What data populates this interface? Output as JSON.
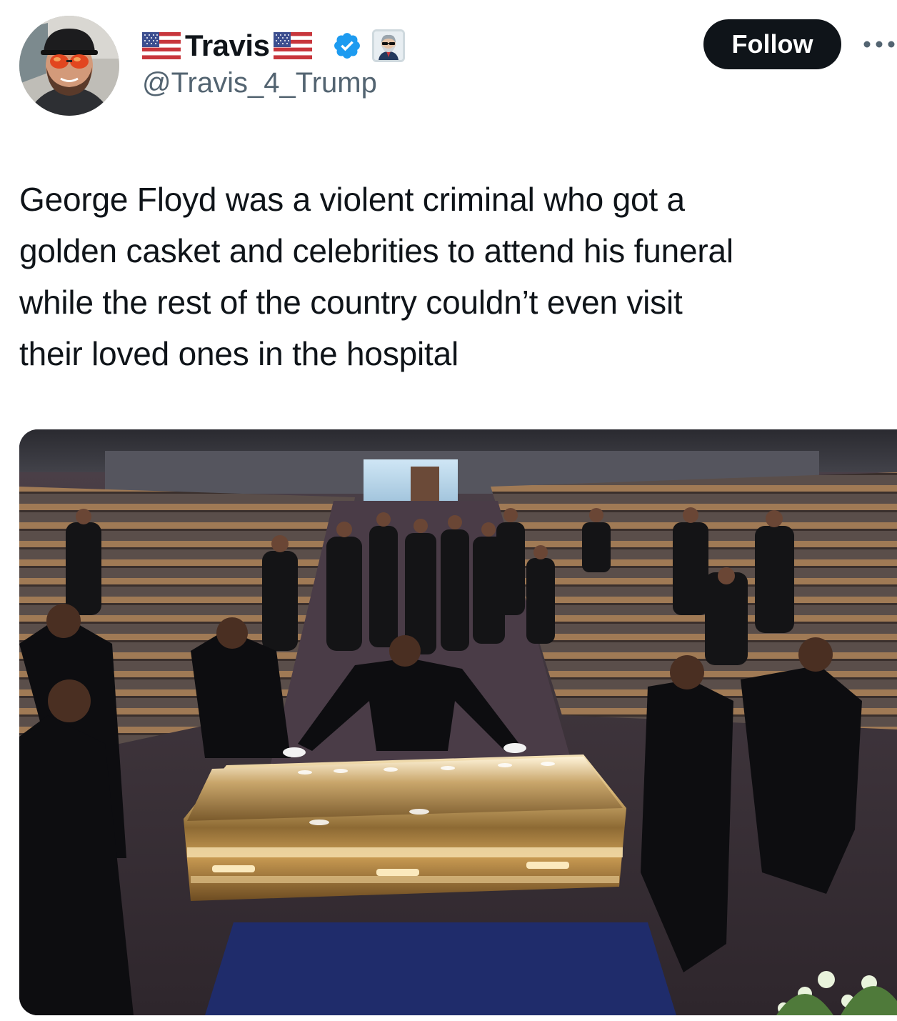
{
  "author": {
    "display_name": "Travis",
    "handle": "@Travis_4_Trump",
    "verified": true,
    "name_flags": [
      "us-flag-icon",
      "us-flag-icon"
    ],
    "affiliation_badge": "bearded-man-sunglasses-badge-icon",
    "avatar": "man-red-sunglasses-cap-avatar"
  },
  "actions": {
    "follow_label": "Follow",
    "more_icon": "more-dots-icon"
  },
  "tweet": {
    "text": "George Floyd was a violent criminal who got a\ngolden casket and celebrities to attend his funeral\nwhile the rest of the country couldn’t even visit\ntheir loved ones in the hospital"
  },
  "media": {
    "type": "photo",
    "content": "golden-casket-in-church-with-pallbearers"
  },
  "colors": {
    "text": "#0f1419",
    "secondary_text": "#536471",
    "verified_blue": "#1d9bf0",
    "button_bg": "#0f1419",
    "button_text": "#ffffff"
  }
}
